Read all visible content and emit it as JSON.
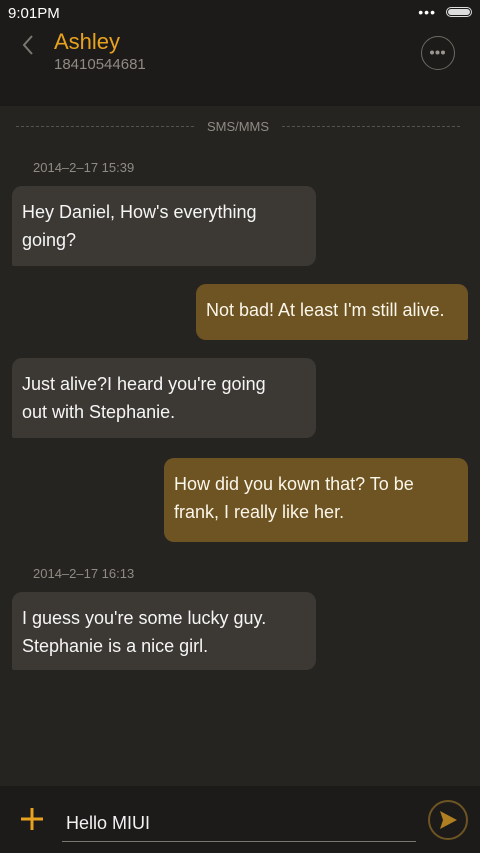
{
  "status_bar": {
    "time": "9:01PM",
    "indicator": "•••"
  },
  "header": {
    "contact_name": "Ashley",
    "contact_number": "18410544681"
  },
  "thread": {
    "channel_label": "SMS/MMS",
    "timestamps": [
      "2014–2–17 15:39",
      "2014–2–17 16:13"
    ],
    "messages": [
      {
        "direction": "in",
        "lines": [
          "Hey Daniel, How's everything",
          "going?"
        ]
      },
      {
        "direction": "out",
        "lines": [
          "Not bad! At least I'm still alive."
        ]
      },
      {
        "direction": "in",
        "lines": [
          "Just  alive?I heard you're going",
          "out with Stephanie."
        ]
      },
      {
        "direction": "out",
        "lines": [
          "How did you kown that? To be",
          "frank, I really like her."
        ]
      },
      {
        "direction": "in",
        "lines": [
          "I guess you're some lucky guy.",
          "Stephanie is a nice girl."
        ]
      }
    ]
  },
  "composer": {
    "value": "Hello MIUI"
  },
  "colors": {
    "accent": "#e9a21f",
    "background": "#262421",
    "incoming_bubble": "#3c3935",
    "outgoing_bubble": "#6d5422"
  },
  "icons": [
    "chevron-left-icon",
    "more-icon",
    "add-icon",
    "send-icon",
    "battery-icon"
  ]
}
